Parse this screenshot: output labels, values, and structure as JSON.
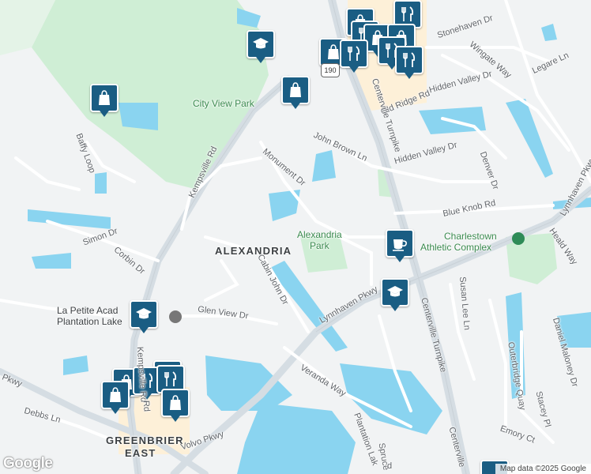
{
  "map": {
    "attribution": "Map data ©2025 Google",
    "logo": "Google",
    "route_shield": "190",
    "colors": {
      "land": "#f1f3f4",
      "water": "#8ad4f0",
      "park": "#cfeed5",
      "road": "#ffffff",
      "major_road": "#d5dde3",
      "pin": "#1a5d83",
      "commercial": "#fdf0d8"
    },
    "area_labels": {
      "alexandria": "ALEXANDRIA",
      "greenbrier_1": "GREENBRIER",
      "greenbrier_2": "EAST"
    },
    "park_labels": {
      "city_view": "City View Park",
      "alexandria_1": "Alexandria",
      "alexandria_2": "Park",
      "charlestown_1": "Charlestown",
      "charlestown_2": "Athletic Complex"
    },
    "poi_labels": {
      "lapetite_1": "La Petite Acad",
      "lapetite_2": "Plantation Lake"
    },
    "roads": {
      "stonehaven": "Stonehaven Dr",
      "wingate": "Wingate Way",
      "legare": "Legare Ln",
      "hidden_valley_dr": "Hidden Valley Dr",
      "old_ridge": "Old Ridge Rd",
      "centerville_1": "Centerville Turnpike",
      "centerville_2": "Centerville Turnpike",
      "centerville_3": "Centerville",
      "john_brown": "John Brown Ln",
      "monument": "Monument Dr",
      "hidden_valley_2": "Hidden Valley Dr",
      "denver": "Denver Dr",
      "blue_knob": "Blue Knob Rd",
      "lynnhaven_1": "Lynnhaven Pkwy",
      "lynnhaven_2": "Lynnhaven Pkwy",
      "heald": "Heald Way",
      "kempsville_1": "Kempsville Rd",
      "kempsville_2": "Kempsville Rd",
      "baffy": "Baffy Loop",
      "simon": "Simon Dr",
      "corbin": "Corbin Dr",
      "cabin_john": "Cabin John Dr",
      "glen_view": "Glen View Dr",
      "susan_lee": "Susan Lee Ln",
      "outerbridge": "Outerbridge Quay",
      "daniel_maloney": "Daniel Maloney Dr",
      "stacey": "Stacey Pl",
      "emory": "Emory Ct",
      "veranda": "Veranda Way",
      "plantation": "Plantation Lak",
      "volvo": "Volvo Pkwy",
      "debbs": "Debbs Ln",
      "pkwy_west": "Pkwy",
      "spruce": "Spruce",
      "gr_rd": "Rd",
      "bottom_rd": "d"
    },
    "markers": [
      {
        "name": "school-top",
        "icon": "school-icon"
      },
      {
        "name": "shopping-left",
        "icon": "shopping-bag-icon"
      },
      {
        "name": "shopping-mid",
        "icon": "shopping-bag-icon"
      },
      {
        "name": "shopping-cluster",
        "icon": "shopping-bag-icon"
      },
      {
        "name": "restaurant-cluster",
        "icon": "restaurant-icon"
      },
      {
        "name": "cafe",
        "icon": "coffee-icon"
      },
      {
        "name": "school-lynnhaven",
        "icon": "school-icon"
      },
      {
        "name": "school-lapetite",
        "icon": "school-icon"
      },
      {
        "name": "restaurant-greenbrier",
        "icon": "restaurant-icon"
      },
      {
        "name": "shopping-greenbrier",
        "icon": "shopping-bag-icon"
      }
    ]
  }
}
